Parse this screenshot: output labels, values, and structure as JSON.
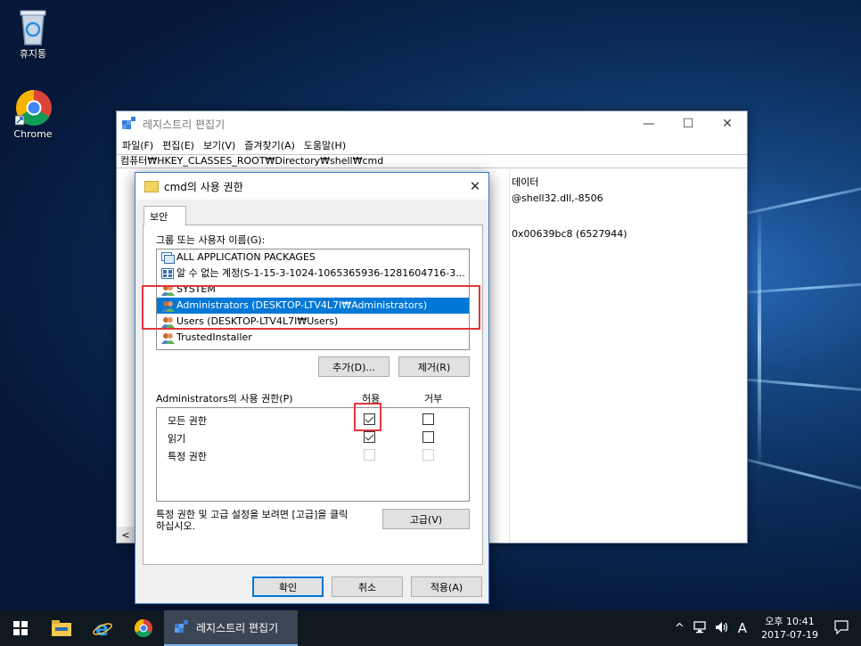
{
  "desktop": {
    "icons": [
      {
        "label": "휴지통"
      },
      {
        "label": "Chrome"
      }
    ]
  },
  "regedit": {
    "title": "레지스트리 편집기",
    "controls": {
      "minimize": "—",
      "maximize": "☐",
      "close": "✕"
    },
    "menu": [
      "파일(F)",
      "편집(E)",
      "보기(V)",
      "즐겨찾기(A)",
      "도움말(H)"
    ],
    "address": "컴퓨터₩HKEY_CLASSES_ROOT₩Directory₩shell₩cmd",
    "values_header": "데이터",
    "values": [
      "@shell32.dll,-8506",
      "",
      "0x00639bc8 (6527944)"
    ],
    "scroll_left": "<"
  },
  "dialog": {
    "title": "cmd의 사용 권한",
    "close": "✕",
    "tab": "보안",
    "groups_label": "그룹 또는 사용자 이름(G):",
    "groups": [
      {
        "name": "ALL APPLICATION PACKAGES",
        "icon": "packages-icon",
        "selected": false
      },
      {
        "name": "알 수 없는 계정(S-1-15-3-1024-1065365936-1281604716-3...",
        "icon": "unknown-account-icon",
        "selected": false
      },
      {
        "name": "SYSTEM",
        "icon": "users-icon",
        "selected": false
      },
      {
        "name": "Administrators (DESKTOP-LTV4L7I₩Administrators)",
        "icon": "users-icon",
        "selected": true
      },
      {
        "name": "Users (DESKTOP-LTV4L7I₩Users)",
        "icon": "users-icon",
        "selected": false
      },
      {
        "name": "TrustedInstaller",
        "icon": "users-icon",
        "selected": false
      }
    ],
    "add_button": "추가(D)...",
    "remove_button": "제거(R)",
    "perm_label": "Administrators의 사용 권한(P)",
    "allow_header": "허용",
    "deny_header": "거부",
    "permissions": [
      {
        "name": "모든 권한",
        "allow": true,
        "deny": false,
        "disabled": false
      },
      {
        "name": "읽기",
        "allow": true,
        "deny": false,
        "disabled": false
      },
      {
        "name": "특정 권한",
        "allow": false,
        "deny": false,
        "disabled": true
      }
    ],
    "advanced_note": "특정 권한 및 고급 설정을 보려면 [고급]을 클릭\n하십시오.",
    "advanced_button": "고급(V)",
    "ok_button": "확인",
    "cancel_button": "취소",
    "apply_button": "적용(A)"
  },
  "taskbar": {
    "active_app": "레지스트리 편집기",
    "tray_chevron": "^",
    "ime": "A",
    "time": "오후 10:41",
    "date": "2017-07-19"
  },
  "colors": {
    "selection": "#0078d7",
    "highlight_box": "#e0363c",
    "taskbar": "#101820"
  }
}
